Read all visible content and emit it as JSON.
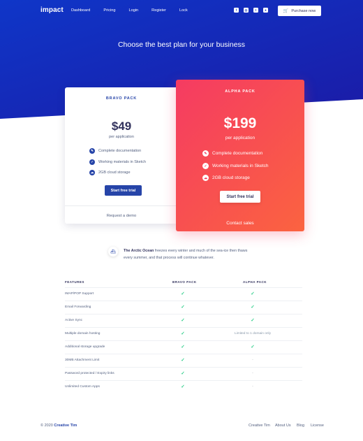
{
  "nav": {
    "logo": "impact",
    "links": [
      "Dashboard",
      "Pricing",
      "Login",
      "Register",
      "Lock"
    ],
    "social_icons": [
      "facebook-icon",
      "instagram-icon",
      "twitter-icon",
      "github-icon"
    ],
    "purchase_label": "Purchase now"
  },
  "hero": {
    "title": "Choose the best plan for your business"
  },
  "bravo": {
    "title": "BRAVO PACK",
    "price": "$49",
    "per": "per application",
    "features": [
      "Complete documentation",
      "Working materials in Sketch",
      "2GB cloud storage"
    ],
    "cta": "Start free trial",
    "footer_link": "Request a demo"
  },
  "alpha": {
    "title": "ALPHA PACK",
    "price": "$199",
    "per": "per application",
    "features": [
      "Complete documentation",
      "Working materials in Sketch",
      "2GB cloud storage"
    ],
    "cta": "Start free trial",
    "footer_link": "Contact sales"
  },
  "info": {
    "highlight": "The Arctic Ocean",
    "text": " freezes every winter and much of the sea-ice then thaws every summer, and that process will continue whatever."
  },
  "table": {
    "headers": [
      "FEATURES",
      "BRAVO PACK",
      "ALPHA PACK"
    ],
    "rows": [
      {
        "feature": "IMAP/POP Support",
        "bravo": "✓",
        "alpha": "✓"
      },
      {
        "feature": "Email Forwarding",
        "bravo": "✓",
        "alpha": "✓"
      },
      {
        "feature": "Active Sync",
        "bravo": "✓",
        "alpha": "✓"
      },
      {
        "feature": "Multiple domain hosting",
        "bravo": "✓",
        "alpha": "Limited to 1 domain only"
      },
      {
        "feature": "Additional storage upgrade",
        "bravo": "✓",
        "alpha": "✓"
      },
      {
        "feature": "30MB Attachment Limit",
        "bravo": "✓",
        "alpha": "-"
      },
      {
        "feature": "Password protected / Expiry links",
        "bravo": "✓",
        "alpha": "-"
      },
      {
        "feature": "Unlimited Custom Apps",
        "bravo": "✓",
        "alpha": "-"
      }
    ]
  },
  "footer": {
    "copyright_prefix": "© 2020",
    "brand": "Creative Tim",
    "links": [
      "Creative Tim",
      "About Us",
      "Blog",
      "License"
    ]
  },
  "colors": {
    "primary": "#2644a8",
    "hero_from": "#1034c4",
    "hero_to": "#1a1aa8",
    "alpha_from": "#f53b62",
    "alpha_to": "#fb6340",
    "check": "#2dce89"
  }
}
